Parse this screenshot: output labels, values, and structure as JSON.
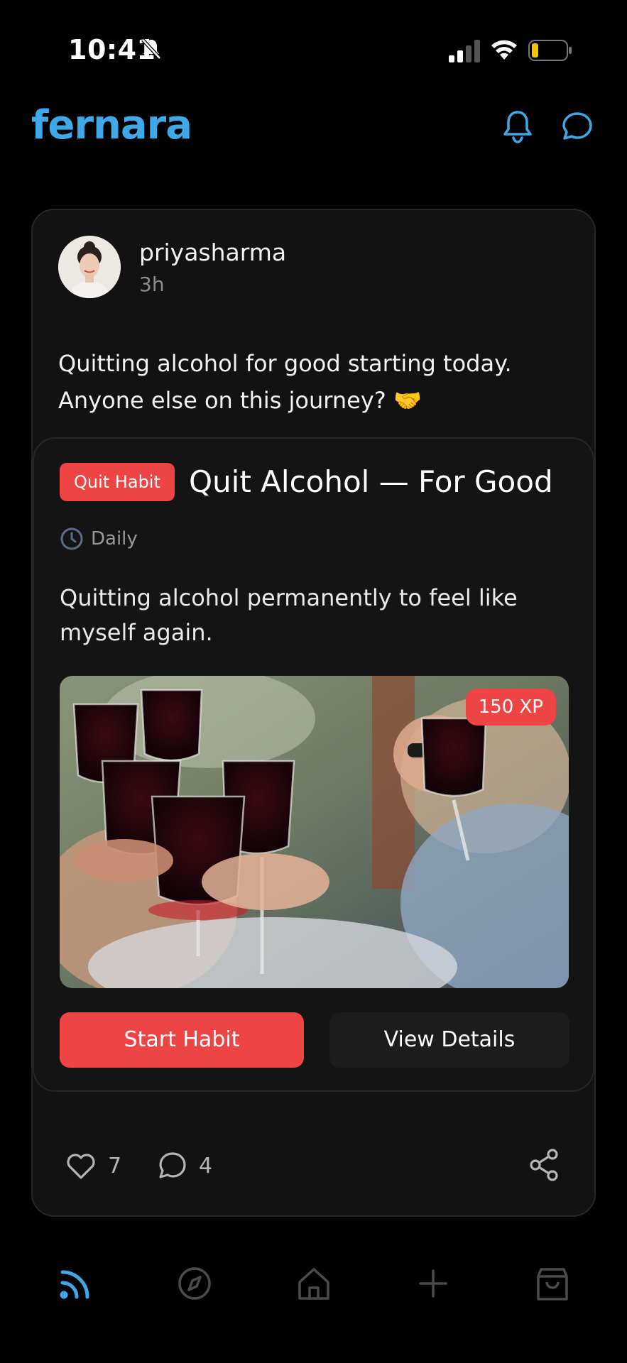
{
  "status_bar": {
    "time": "10:41"
  },
  "header": {
    "logo": "fernara"
  },
  "post": {
    "username": "priyasharma",
    "time_ago": "3h",
    "text_line1": "Quitting alcohol for good starting today.",
    "text_line2": "Anyone else on this journey? 🤝",
    "habit": {
      "badge": "Quit Habit",
      "title": "Quit Alcohol — For Good",
      "frequency": "Daily",
      "description": "Quitting alcohol permanently to feel like myself again.",
      "xp": "150 XP",
      "start_label": "Start Habit",
      "details_label": "View Details"
    },
    "likes": "7",
    "comments": "4"
  },
  "nav": {
    "items": [
      "feed-icon",
      "explore-icon",
      "home-icon",
      "add-icon",
      "shop-icon"
    ],
    "active": "feed-icon"
  },
  "colors": {
    "brand": "#3fa8e8",
    "accent": "#ef4444"
  }
}
